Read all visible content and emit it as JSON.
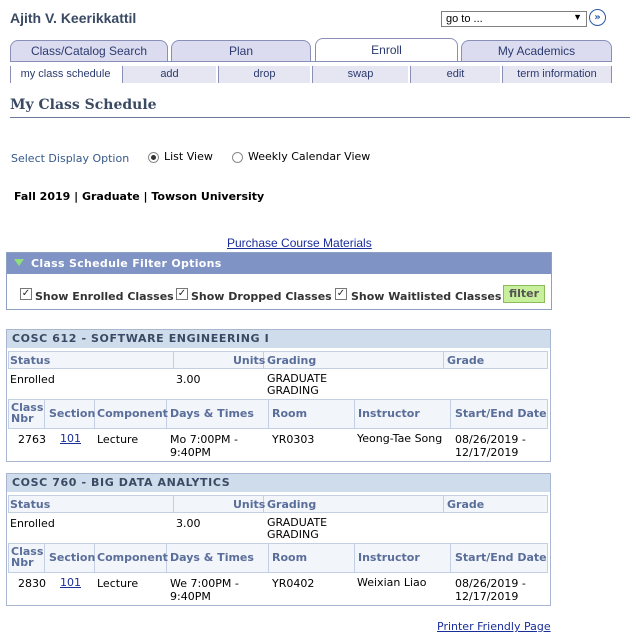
{
  "header": {
    "student_name": "Ajith V. Keerikkattil",
    "goto_value": "go to ...",
    "goto_button_glyph": "»"
  },
  "tabs": [
    {
      "label": "Class/Catalog Search"
    },
    {
      "label": "Plan"
    },
    {
      "label": "Enroll"
    },
    {
      "label": "My Academics"
    }
  ],
  "subtabs": [
    {
      "label": "my class schedule"
    },
    {
      "label": "add"
    },
    {
      "label": "drop"
    },
    {
      "label": "swap"
    },
    {
      "label": "edit"
    },
    {
      "label": "term information"
    }
  ],
  "page_title": "My Class Schedule",
  "display_option": {
    "label": "Select Display Option",
    "list_view": "List View",
    "weekly_view": "Weekly Calendar View",
    "selected": "List View"
  },
  "term_line": "Fall 2019 | Graduate | Towson University",
  "purchase_link": "Purchase Course Materials",
  "filter": {
    "title": "Class Schedule Filter Options",
    "enrolled": "Show Enrolled Classes",
    "dropped": "Show Dropped Classes",
    "waitlisted": "Show Waitlisted Classes",
    "button": "filter",
    "check_glyph": "✓"
  },
  "table_headers": {
    "status": "Status",
    "units": "Units",
    "grading": "Grading",
    "grade": "Grade",
    "class_nbr": "Class Nbr",
    "section": "Section",
    "component": "Component",
    "days_times": "Days & Times",
    "room": "Room",
    "instructor": "Instructor",
    "start_end": "Start/End Date"
  },
  "courses": [
    {
      "title": "COSC 612 - SOFTWARE ENGINEERING I",
      "status": "Enrolled",
      "units": "3.00",
      "grading": "GRADUATE GRADING",
      "grade": "",
      "class_nbr": "2763",
      "section": "101",
      "component": "Lecture",
      "days_times": "Mo 7:00PM - 9:40PM",
      "room": "YR0303",
      "instructor": "Yeong-Tae Song",
      "start_end": "08/26/2019 - 12/17/2019"
    },
    {
      "title": "COSC 760 - BIG DATA ANALYTICS",
      "status": "Enrolled",
      "units": "3.00",
      "grading": "GRADUATE GRADING",
      "grade": "",
      "class_nbr": "2830",
      "section": "101",
      "component": "Lecture",
      "days_times": "We 7:00PM - 9:40PM",
      "room": "YR0402",
      "instructor": "Weixian Liao",
      "start_end": "08/26/2019 - 12/17/2019"
    }
  ],
  "printer_link": "Printer Friendly Page",
  "colors": {
    "accent": "#7f93c4",
    "title_text": "#3a4a63",
    "link": "#1a2e9a",
    "filter_button": "#c8ef9b"
  }
}
